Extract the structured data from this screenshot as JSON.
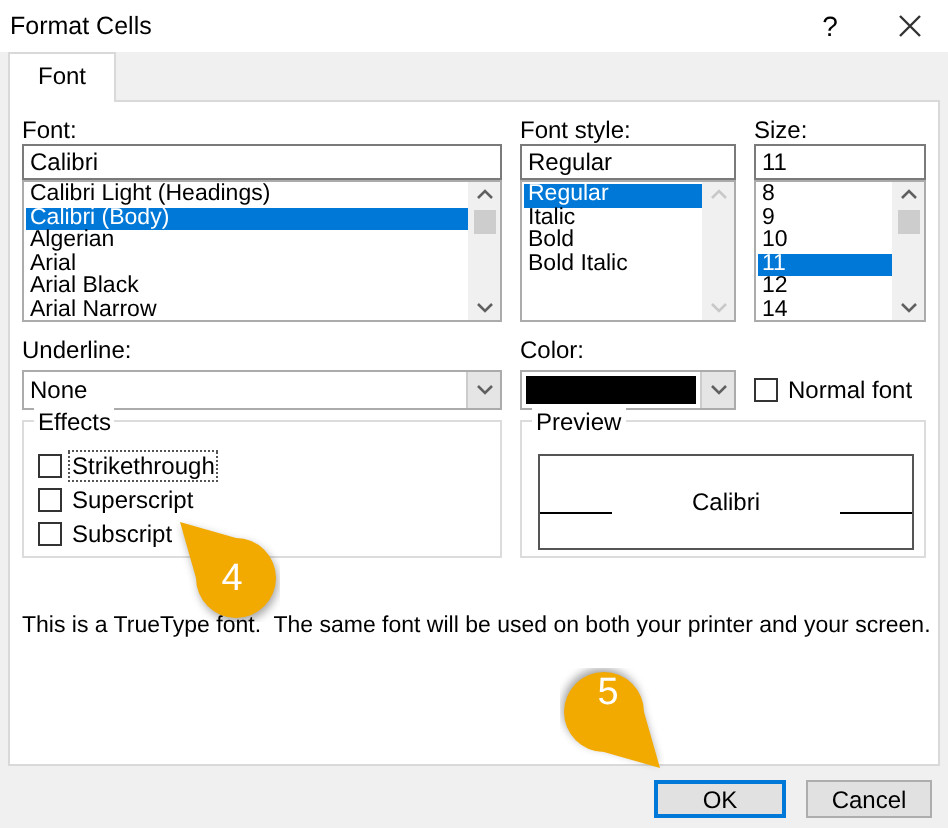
{
  "window": {
    "title": "Format Cells",
    "help": "?"
  },
  "tabs": [
    {
      "label": "Font",
      "selected": true
    }
  ],
  "font": {
    "label": "Font:",
    "value": "Calibri",
    "scrollable": true,
    "items": [
      {
        "label": "Calibri Light (Headings)",
        "selected": false
      },
      {
        "label": "Calibri (Body)",
        "selected": true
      },
      {
        "label": "Algerian",
        "selected": false
      },
      {
        "label": "Arial",
        "selected": false
      },
      {
        "label": "Arial Black",
        "selected": false
      },
      {
        "label": "Arial Narrow",
        "selected": false
      }
    ]
  },
  "font_style": {
    "label": "Font style:",
    "value": "Regular",
    "scrollable": false,
    "items": [
      {
        "label": "Regular",
        "selected": true
      },
      {
        "label": "Italic",
        "selected": false
      },
      {
        "label": "Bold",
        "selected": false
      },
      {
        "label": "Bold Italic",
        "selected": false
      }
    ]
  },
  "size": {
    "label": "Size:",
    "value": "11",
    "scrollable": true,
    "items": [
      {
        "label": "8",
        "selected": false
      },
      {
        "label": "9",
        "selected": false
      },
      {
        "label": "10",
        "selected": false
      },
      {
        "label": "11",
        "selected": true
      },
      {
        "label": "12",
        "selected": false
      },
      {
        "label": "14",
        "selected": false
      }
    ]
  },
  "underline": {
    "label": "Underline:",
    "value": "None"
  },
  "color": {
    "label": "Color:",
    "color": "#000000"
  },
  "normal_font": {
    "label": "Normal font",
    "checked": false
  },
  "effects": {
    "title": "Effects",
    "options": [
      {
        "label": "Strikethrough",
        "checked": false,
        "focused": true
      },
      {
        "label": "Superscript",
        "checked": false,
        "focused": false
      },
      {
        "label": "Subscript",
        "checked": false,
        "focused": false
      }
    ]
  },
  "preview": {
    "title": "Preview",
    "sample": "Calibri"
  },
  "note": "This is a TrueType font.  The same font will be used on both your printer and your screen.",
  "buttons": [
    {
      "label": "OK",
      "default": true
    },
    {
      "label": "Cancel",
      "default": false
    }
  ],
  "callouts": [
    {
      "label": "4"
    },
    {
      "label": "5"
    }
  ]
}
